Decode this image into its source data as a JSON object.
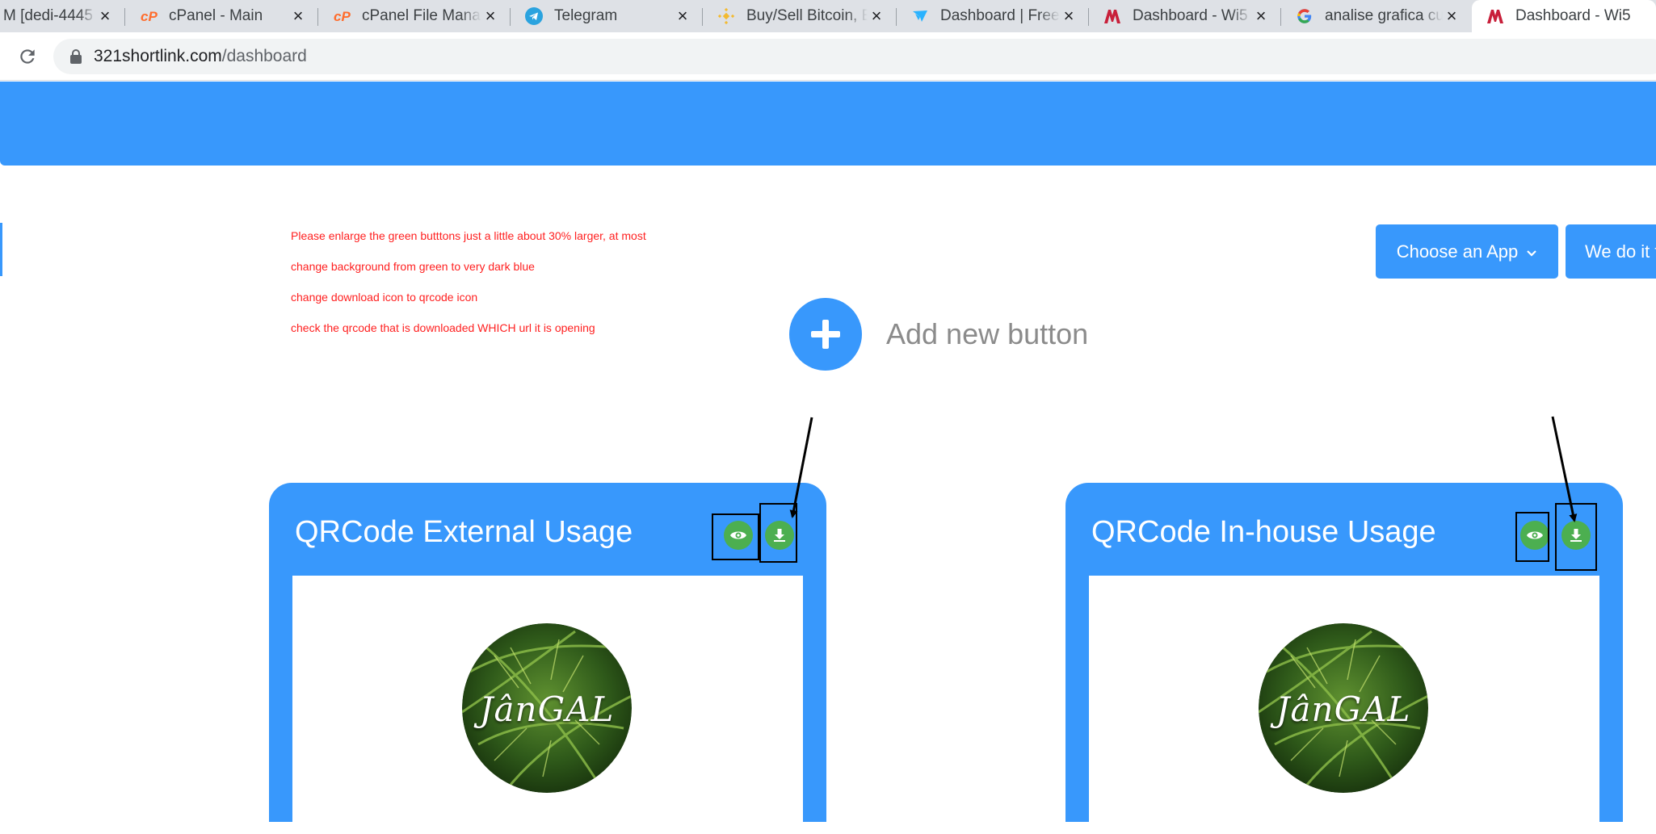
{
  "browser": {
    "tabs": [
      {
        "title": "M [dedi-4445"
      },
      {
        "title": "cPanel - Main"
      },
      {
        "title": "cPanel File Manager"
      },
      {
        "title": "Telegram"
      },
      {
        "title": "Buy/Sell Bitcoin, E"
      },
      {
        "title": "Dashboard | Freelancer"
      },
      {
        "title": "Dashboard - Wi5"
      },
      {
        "title": "analise grafica cur"
      },
      {
        "title": "Dashboard - Wi5"
      }
    ],
    "url_host": "321shortlink.com",
    "url_path": "/dashboard"
  },
  "notes": [
    "Please enlarge the  green butttons just a little about 30% larger, at most",
    "change background from green to very dark blue",
    "change download icon to qrcode icon",
    "check the qrcode that is downloaded WHICH url it is opening"
  ],
  "header_buttons": {
    "choose_app": "Choose an App",
    "we_do_it": "We do it f"
  },
  "add_new_button": "Add new button",
  "cards": [
    {
      "title": "QRCode External Usage",
      "logo_text": "JânGAL"
    },
    {
      "title": "QRCode In-house Usage",
      "logo_text": "JânGAL"
    }
  ],
  "colors": {
    "primary": "#3898fc",
    "green_button": "#4caf50",
    "note_red": "#ff1f1f"
  }
}
